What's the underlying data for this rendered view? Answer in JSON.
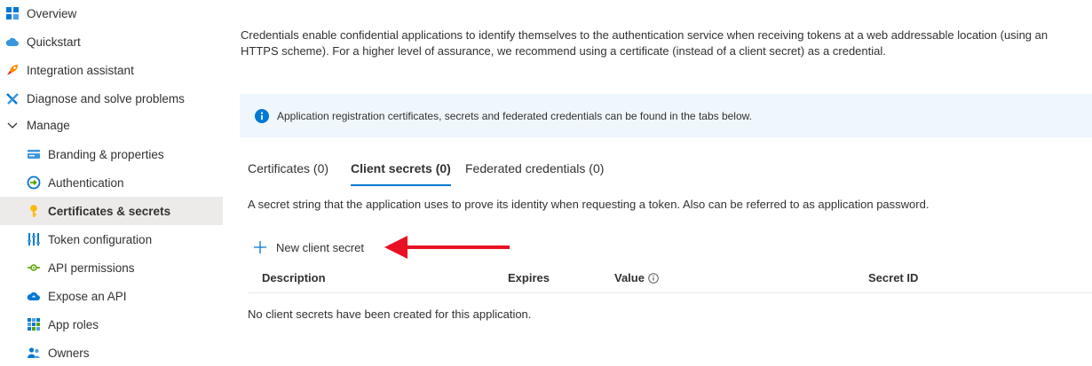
{
  "sidebar": {
    "items": [
      {
        "label": "Overview",
        "icon": "overview-grid-icon"
      },
      {
        "label": "Quickstart",
        "icon": "cloud-icon"
      },
      {
        "label": "Integration assistant",
        "icon": "rocket-icon"
      },
      {
        "label": "Diagnose and solve problems",
        "icon": "wrench-icon"
      },
      {
        "label": "Manage",
        "icon": "chevron-down-icon"
      },
      {
        "label": "Branding & properties",
        "icon": "branding-card-icon"
      },
      {
        "label": "Authentication",
        "icon": "authentication-icon"
      },
      {
        "label": "Certificates & secrets",
        "icon": "key-icon",
        "selected": true
      },
      {
        "label": "Token configuration",
        "icon": "token-bars-icon"
      },
      {
        "label": "API permissions",
        "icon": "api-permissions-icon"
      },
      {
        "label": "Expose an API",
        "icon": "cloud-api-icon"
      },
      {
        "label": "App roles",
        "icon": "app-roles-grid-icon"
      },
      {
        "label": "Owners",
        "icon": "people-icon"
      }
    ]
  },
  "main": {
    "intro": "Credentials enable confidential applications to identify themselves to the authentication service when receiving tokens at a web addressable location (using an HTTPS scheme). For a higher level of assurance, we recommend using a certificate (instead of a client secret) as a credential.",
    "info_banner": "Application registration certificates, secrets and federated credentials can be found in the tabs below.",
    "tabs": [
      {
        "label": "Certificates (0)"
      },
      {
        "label": "Client secrets (0)",
        "active": true
      },
      {
        "label": "Federated credentials (0)"
      }
    ],
    "secret_description": "A secret string that the application uses to prove its identity when requesting a token. Also can be referred to as application password.",
    "new_secret_label": "New client secret",
    "table": {
      "columns": [
        "Description",
        "Expires",
        "Value",
        "Secret ID"
      ],
      "empty_message": "No client secrets have been created for this application."
    }
  },
  "colors": {
    "accent": "#0078d4",
    "banner_bg": "#eff6fc",
    "selected_bg": "#edebe9",
    "arrow": "#e81123"
  }
}
